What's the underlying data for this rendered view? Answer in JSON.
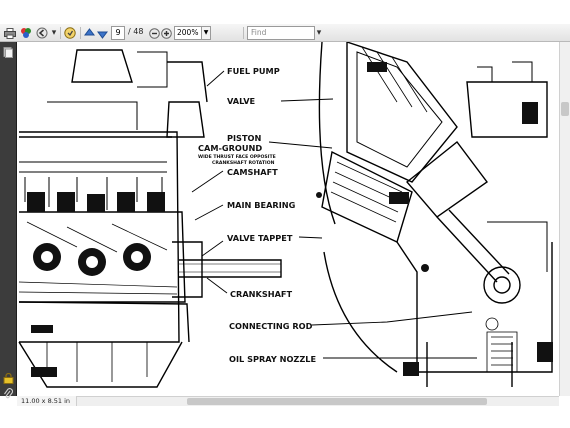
{
  "toolbar": {
    "page_current": "9",
    "page_total": "/ 48",
    "zoom": "200%",
    "find_placeholder": "Find",
    "icons": [
      "print-icon",
      "tools-icon",
      "back-icon",
      "save-icon",
      "prev-page-icon",
      "next-page-icon",
      "zoom-out-icon",
      "zoom-in-icon",
      "zoom-dropdown-icon"
    ]
  },
  "sidebar": {
    "icons": [
      "pages-panel-icon",
      "lock-icon",
      "attachment-icon"
    ]
  },
  "document": {
    "labels": {
      "fuel_pump": "FUEL PUMP",
      "valve": "VALVE",
      "piston": "PISTON",
      "cam_ground": "CAM-GROUND",
      "wide_thrust": "WIDE THRUST FACE OPPOSITE",
      "crank_rotation": "CRANKSHAFT ROTATION",
      "camshaft": "CAMSHAFT",
      "main_bearing": "MAIN BEARING",
      "valve_tappet": "VALVE TAPPET",
      "crankshaft": "CRANKSHAFT",
      "connecting_rod": "CONNECTING ROD",
      "oil_spray_nozzle": "OIL SPRAY NOZZLE"
    }
  },
  "status": {
    "page_size": "11.00 x 8.51 in"
  }
}
